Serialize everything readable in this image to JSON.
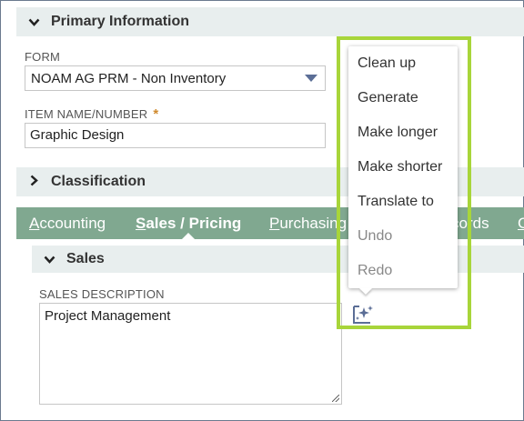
{
  "primary_section": {
    "title": "Primary Information"
  },
  "form": {
    "label": "FORM",
    "value": "NOAM AG PRM - Non Inventory"
  },
  "item_name": {
    "label": "ITEM NAME/NUMBER",
    "required_mark": "*",
    "value": "Graphic Design"
  },
  "classification_section": {
    "title": "Classification"
  },
  "tabs": [
    {
      "first": "A",
      "rest": "ccounting"
    },
    {
      "first": "S",
      "rest": "ales / Pricing"
    },
    {
      "first": "P",
      "rest": "urchasing"
    },
    {
      "first": "",
      "rest": "cords"
    },
    {
      "first": "C",
      "rest": ""
    }
  ],
  "sales_section": {
    "title": "Sales"
  },
  "sales_description": {
    "label": "SALES DESCRIPTION",
    "value": "Project Management"
  },
  "ai_menu": {
    "items": [
      "Clean up",
      "Generate",
      "Make longer",
      "Make shorter",
      "Translate to",
      "Undo",
      "Redo"
    ]
  },
  "colors": {
    "tab_bar": "#80a890",
    "highlight": "#a8d53a",
    "section_bg": "#e8eeee"
  },
  "icons": {
    "ai_assist": "sparkle-edit-icon"
  }
}
